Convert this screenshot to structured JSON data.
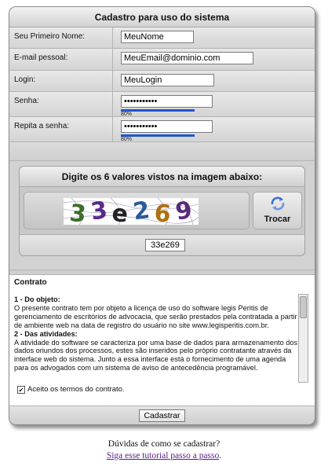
{
  "form": {
    "title": "Cadastro para uso do sistema",
    "fields": [
      {
        "label": "Seu Primeiro Nome:",
        "value": "MeuNome"
      },
      {
        "label": "E-mail pessoal:",
        "value": "MeuEmail@dominio.com"
      },
      {
        "label": "Login:",
        "value": "MeuLogin"
      },
      {
        "label": "Senha:",
        "value": "•••••••••••",
        "strength_label": "80%",
        "strength": 0.8
      },
      {
        "label": "Repita a senha:",
        "value": "•••••••••••",
        "strength_label": "80%",
        "strength": 0.8
      }
    ]
  },
  "captcha": {
    "heading": "Digite os 6 valores vistos na imagem abaixo:",
    "refresh_label": "Trocar",
    "refresh_icon": "refresh-icon",
    "input_value": "33e269",
    "image_glyphs": [
      "3",
      "3",
      "e",
      "2",
      "6",
      "9"
    ]
  },
  "contract": {
    "title": "Contrato",
    "s1_title": "1 - Do objeto:",
    "s1_text": "O presente contrato tem por objeto a licença de uso do software legis Peritis de gerenciamento de escritórios de advocacia, que serão prestados pela contratada a partir de ambiente web na data de registro do usuário no site www.legisperitis.com.br.",
    "s2_title": "2 - Das atividades:",
    "s2_text": "A atividade do software se caracteriza por uma base de dados para armazenamento dos dados oriundos dos processos, estes são inseridos pelo próprio contratante através da interface web do sistema. Junto a essa interface está o fornecimento de uma agenda para os advogados com um sistema de aviso de antecedência programável.",
    "agree_label": "Aceito os termos do contrato.",
    "agree_checked": true
  },
  "submit_label": "Cadastrar",
  "help": {
    "question": "Dúvidas de como se cadastrar?",
    "link_text": "Siga esse tutorial passo a passo",
    "suffix": "."
  },
  "colors": {
    "panel": "#cfcfcf",
    "strength_fill": "#2255cc",
    "link": "#5a1a8a"
  }
}
